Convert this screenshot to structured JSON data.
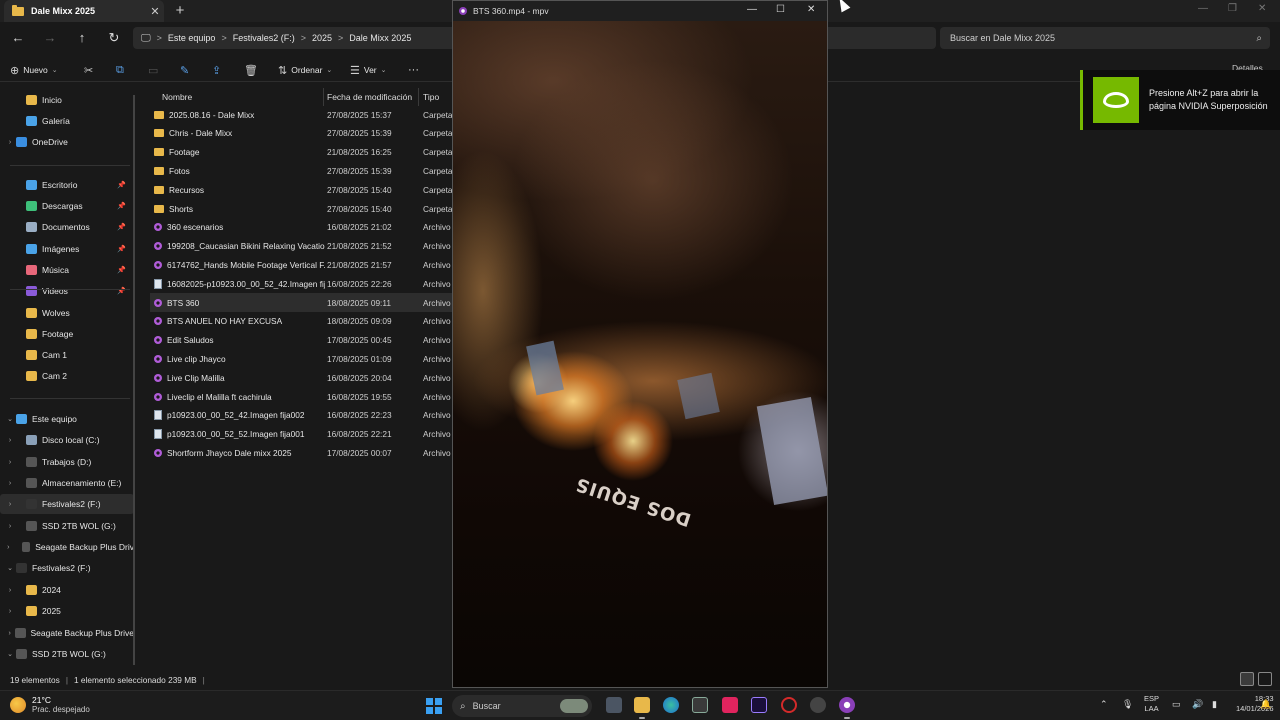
{
  "explorer": {
    "tab_title": "Dale Mixx 2025",
    "tab_close": "✕",
    "new_tab": "+",
    "breadcrumb": [
      "Este equipo",
      "Festivales2 (F:)",
      "2025",
      "Dale Mixx 2025"
    ],
    "breadcrumb_sep": ">",
    "search_placeholder": "Buscar en Dale Mixx 2025",
    "toolbar": {
      "new_label": "Nuevo",
      "sort_label": "Ordenar",
      "view_label": "Ver",
      "more_label": "···",
      "details_label": "Detalles"
    },
    "columns": {
      "name": "Nombre",
      "date": "Fecha de modificación",
      "type": "Tipo"
    },
    "files": [
      {
        "name": "2025.08.16 - Dale Mixx",
        "date": "27/08/2025 15:37",
        "type": "Carpeta",
        "icon": "folder"
      },
      {
        "name": "Chris - Dale Mixx",
        "date": "27/08/2025 15:39",
        "type": "Carpeta",
        "icon": "folder"
      },
      {
        "name": "Footage",
        "date": "21/08/2025 16:25",
        "type": "Carpeta",
        "icon": "folder"
      },
      {
        "name": "Fotos",
        "date": "27/08/2025 15:39",
        "type": "Carpeta",
        "icon": "folder"
      },
      {
        "name": "Recursos",
        "date": "27/08/2025 15:40",
        "type": "Carpeta",
        "icon": "folder"
      },
      {
        "name": "Shorts",
        "date": "27/08/2025 15:40",
        "type": "Carpeta",
        "icon": "folder"
      },
      {
        "name": "360 escenarios",
        "date": "16/08/2025 21:02",
        "type": "Archivo",
        "icon": "video"
      },
      {
        "name": "199208_Caucasian Bikini Relaxing Vacatio...",
        "date": "21/08/2025 21:52",
        "type": "Archivo",
        "icon": "video"
      },
      {
        "name": "6174762_Hands Mobile Footage Vertical F...",
        "date": "21/08/2025 21:57",
        "type": "Archivo",
        "icon": "video"
      },
      {
        "name": "16082025-p10923.00_00_52_42.Imagen fij...",
        "date": "16/08/2025 22:26",
        "type": "Archivo",
        "icon": "doc"
      },
      {
        "name": "BTS 360",
        "date": "18/08/2025 09:11",
        "type": "Archivo",
        "icon": "video",
        "selected": true
      },
      {
        "name": "BTS ANUEL NO HAY EXCUSA",
        "date": "18/08/2025 09:09",
        "type": "Archivo",
        "icon": "video"
      },
      {
        "name": "Edit Saludos",
        "date": "17/08/2025 00:45",
        "type": "Archivo",
        "icon": "video"
      },
      {
        "name": "Live clip Jhayco",
        "date": "17/08/2025 01:09",
        "type": "Archivo",
        "icon": "video"
      },
      {
        "name": "Live Clip Malilla",
        "date": "16/08/2025 20:04",
        "type": "Archivo",
        "icon": "video"
      },
      {
        "name": "Liveclip el Malilla ft cachirula",
        "date": "16/08/2025 19:55",
        "type": "Archivo",
        "icon": "video"
      },
      {
        "name": "p10923.00_00_52_42.Imagen fija002",
        "date": "16/08/2025 22:23",
        "type": "Archivo",
        "icon": "doc"
      },
      {
        "name": "p10923.00_00_52_52.Imagen fija001",
        "date": "16/08/2025 22:21",
        "type": "Archivo",
        "icon": "doc"
      },
      {
        "name": "Shortform Jhayco Dale mixx 2025",
        "date": "17/08/2025 00:07",
        "type": "Archivo",
        "icon": "video"
      }
    ],
    "sidebar": [
      {
        "label": "Inicio",
        "icon": "home-icon",
        "color": "#e8b84a",
        "arrow": "",
        "pin": false
      },
      {
        "label": "Galería",
        "icon": "gallery-icon",
        "color": "#4aa3e8",
        "arrow": "",
        "pin": false
      },
      {
        "label": "OneDrive",
        "icon": "cloud-icon",
        "color": "#3a8ee0",
        "arrow": "›",
        "pin": false
      },
      {
        "label": "Escritorio",
        "icon": "desktop-icon",
        "color": "#4aa3e8",
        "arrow": "",
        "pin": true
      },
      {
        "label": "Descargas",
        "icon": "download-icon",
        "color": "#3ec07a",
        "arrow": "",
        "pin": true
      },
      {
        "label": "Documentos",
        "icon": "documents-icon",
        "color": "#9aaec4",
        "arrow": "",
        "pin": true
      },
      {
        "label": "Imágenes",
        "icon": "pictures-icon",
        "color": "#4aa3e8",
        "arrow": "",
        "pin": true
      },
      {
        "label": "Música",
        "icon": "music-icon",
        "color": "#e8677a",
        "arrow": "",
        "pin": true
      },
      {
        "label": "Videos",
        "icon": "videos-icon",
        "color": "#8a5ad8",
        "arrow": "",
        "pin": true
      },
      {
        "label": "Wolves",
        "icon": "folder-icon",
        "color": "#e8b84a",
        "arrow": "",
        "pin": false
      },
      {
        "label": "Footage",
        "icon": "folder-icon",
        "color": "#e8b84a",
        "arrow": "",
        "pin": false
      },
      {
        "label": "Cam 1",
        "icon": "folder-icon",
        "color": "#e8b84a",
        "arrow": "",
        "pin": false
      },
      {
        "label": "Cam 2",
        "icon": "folder-icon",
        "color": "#e8b84a",
        "arrow": "",
        "pin": false
      },
      {
        "label": "Este equipo",
        "icon": "computer-icon",
        "color": "#4aa3e8",
        "arrow": "⌄",
        "pin": false
      },
      {
        "label": "Disco local (C:)",
        "icon": "drive-icon",
        "color": "#8aa0b8",
        "arrow": "›",
        "pin": false
      },
      {
        "label": "Trabajos (D:)",
        "icon": "drive-icon",
        "color": "#555",
        "arrow": "›",
        "pin": false
      },
      {
        "label": "Almacenamiento  (E:)",
        "icon": "drive-icon",
        "color": "#555",
        "arrow": "›",
        "pin": false
      },
      {
        "label": "Festivales2 (F:)",
        "icon": "drive-icon",
        "color": "#333",
        "arrow": "›",
        "pin": false,
        "selected": true
      },
      {
        "label": "SSD 2TB WOL (G:)",
        "icon": "drive-icon",
        "color": "#555",
        "arrow": "›",
        "pin": false
      },
      {
        "label": "Seagate Backup Plus Driv",
        "icon": "drive-icon",
        "color": "#555",
        "arrow": "›",
        "pin": false
      },
      {
        "label": "Festivales2 (F:)",
        "icon": "drive-icon",
        "color": "#333",
        "arrow": "⌄",
        "pin": false
      },
      {
        "label": "2024",
        "icon": "folder-icon",
        "color": "#e8b84a",
        "arrow": "›",
        "pin": false
      },
      {
        "label": "2025",
        "icon": "folder-icon",
        "color": "#e8b84a",
        "arrow": "›",
        "pin": false
      },
      {
        "label": "Seagate Backup Plus Drive",
        "icon": "drive-icon",
        "color": "#555",
        "arrow": "›",
        "pin": false
      },
      {
        "label": "SSD 2TB WOL (G:)",
        "icon": "drive-icon",
        "color": "#555",
        "arrow": "⌄",
        "pin": false
      }
    ],
    "status": {
      "count": "19 elementos",
      "selection": "1 elemento seleccionado  239 MB",
      "sep": "|"
    }
  },
  "mpv": {
    "title": "BTS 360.mp4 - mpv",
    "stage_text": "DOS EQUIS"
  },
  "nvidia": {
    "text": "Presione Alt+Z para abrir la página NVIDIA Superposición",
    "accent": "#76b900"
  },
  "taskbar": {
    "temp": "21°C",
    "weather": "Prac. despejado",
    "search_placeholder": "Buscar",
    "lang_line1": "ESP",
    "lang_line2": "LAA",
    "time": "18:33",
    "date": "14/01/2026"
  }
}
